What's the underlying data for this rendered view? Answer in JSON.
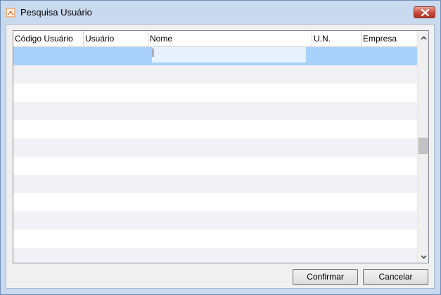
{
  "window": {
    "title": "Pesquisa Usuário"
  },
  "grid": {
    "columns": [
      "Código Usuário",
      "Usuário",
      "Nome",
      "U.N.",
      "Empresa"
    ]
  },
  "buttons": {
    "confirm_label": "Confirmar",
    "cancel_label": "Cancelar"
  }
}
